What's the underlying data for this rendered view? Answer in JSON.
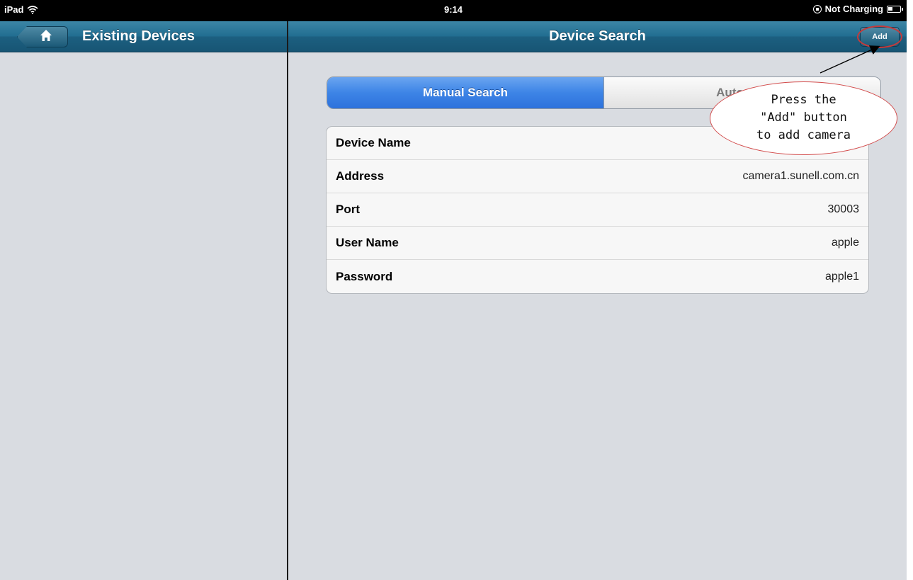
{
  "status_bar": {
    "device": "iPad",
    "time": "9:14",
    "charging": "Not Charging"
  },
  "left_nav": {
    "home_icon": "home-icon",
    "title": "Existing Devices"
  },
  "right_nav": {
    "title": "Device Search",
    "add_label": "Add"
  },
  "segments": [
    {
      "label": "Manual Search",
      "active": true
    },
    {
      "label": "Automati",
      "active": false
    }
  ],
  "form": {
    "rows": [
      {
        "label": "Device Name",
        "value": ""
      },
      {
        "label": "Address",
        "value": "camera1.sunell.com.cn"
      },
      {
        "label": "Port",
        "value": "30003"
      },
      {
        "label": "User Name",
        "value": "apple"
      },
      {
        "label": "Password",
        "value": "apple1"
      }
    ]
  },
  "annotation": {
    "line1": "Press the",
    "line2": "\"Add\" button",
    "line3": "to add camera"
  },
  "colors": {
    "nav_bar": "#226e91",
    "segment_active": "#3d84e6",
    "annotation_red": "#d24a4a",
    "background": "#d9dce1"
  }
}
